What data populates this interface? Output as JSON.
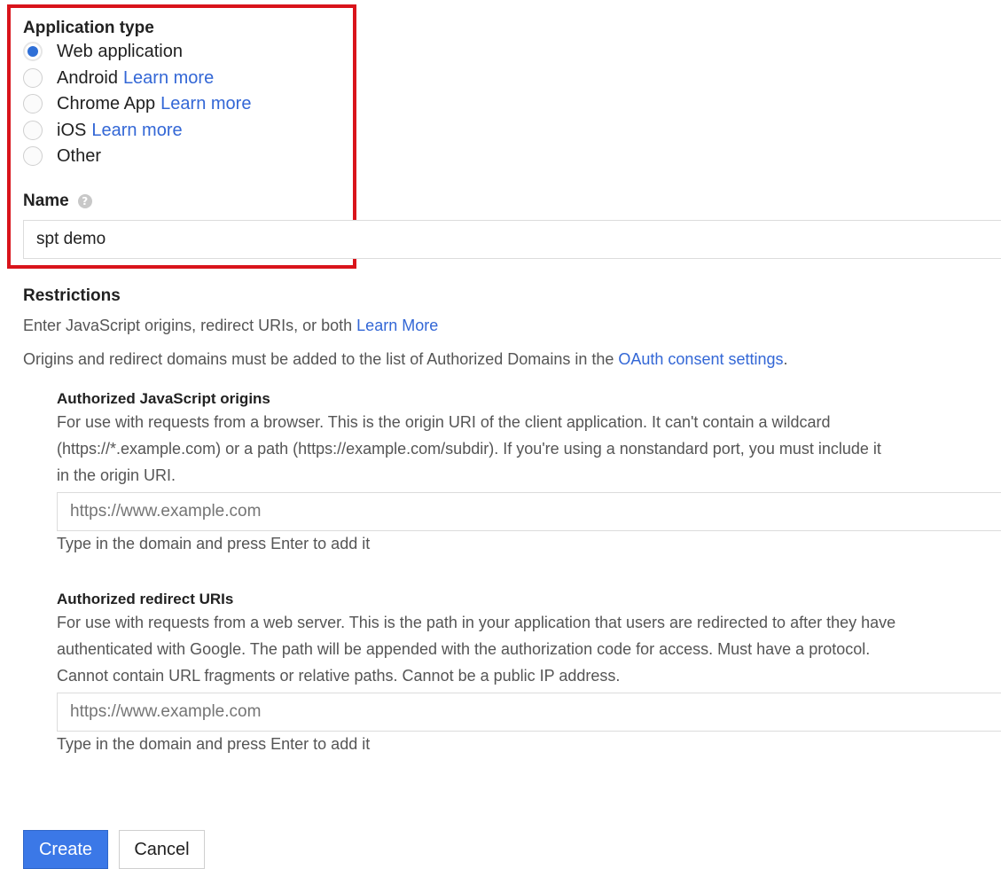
{
  "application_type": {
    "title": "Application type",
    "selected": "Web application",
    "options": [
      {
        "label": "Web application",
        "link": ""
      },
      {
        "label": "Android",
        "link": "Learn more"
      },
      {
        "label": "Chrome App",
        "link": "Learn more"
      },
      {
        "label": "iOS",
        "link": "Learn more"
      },
      {
        "label": "Other",
        "link": ""
      }
    ]
  },
  "name": {
    "label": "Name",
    "help_icon": "help-icon",
    "value": "spt demo"
  },
  "restrictions": {
    "title": "Restrictions",
    "intro_text": "Enter JavaScript origins, redirect URIs, or both",
    "intro_link": "Learn More",
    "domains_text": "Origins and redirect domains must be added to the list of Authorized Domains in the",
    "domains_link": "OAuth consent settings",
    "domains_suffix": "."
  },
  "js_origins": {
    "title": "Authorized JavaScript origins",
    "desc_lines": [
      "For use with requests from a browser. This is the origin URI of the client application. It can't contain a wildcard",
      "(https://*.example.com) or a path (https://example.com/subdir). If you're using a nonstandard port, you must include it",
      "in the origin URI."
    ],
    "placeholder": "https://www.example.com",
    "hint": "Type in the domain and press Enter to add it"
  },
  "redirect_uris": {
    "title": "Authorized redirect URIs",
    "desc_lines": [
      "For use with requests from a web server. This is the path in your application that users are redirected to after they have",
      "authenticated with Google. The path will be appended with the authorization code for access. Must have a protocol.",
      "Cannot contain URL fragments or relative paths. Cannot be a public IP address."
    ],
    "placeholder": "https://www.example.com",
    "hint": "Type in the domain and press Enter to add it"
  },
  "actions": {
    "create_label": "Create",
    "cancel_label": "Cancel"
  },
  "colors": {
    "accent": "#3b78e7",
    "link": "#3367d6",
    "highlight": "#d9141b"
  }
}
